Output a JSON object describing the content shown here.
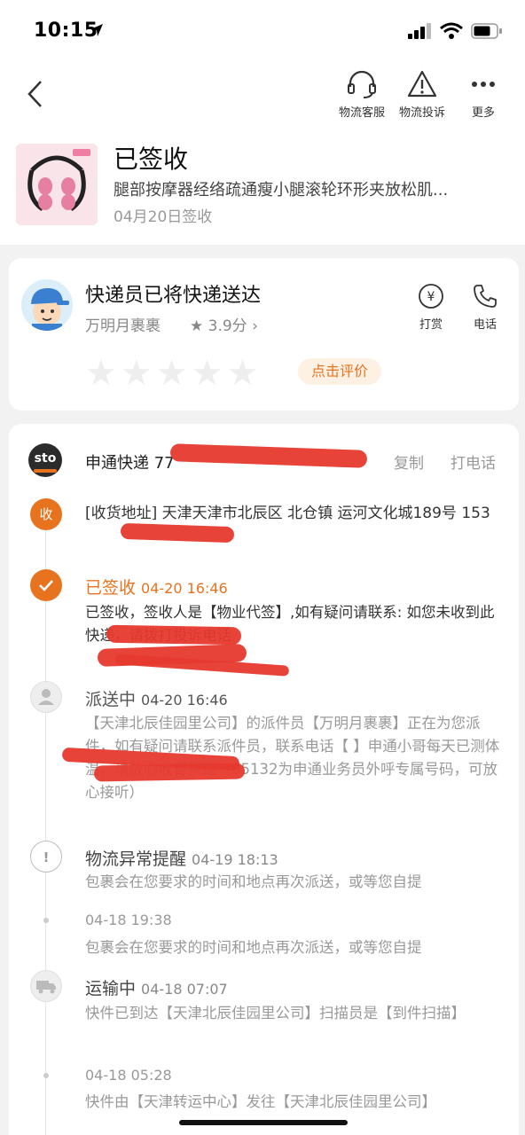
{
  "status_bar": {
    "time": "10:15"
  },
  "nav": {
    "actions": [
      {
        "label": "物流客服",
        "icon": "headset-icon"
      },
      {
        "label": "物流投诉",
        "icon": "warning-icon"
      },
      {
        "label": "更多",
        "icon": "more-icon"
      }
    ]
  },
  "product": {
    "status": "已签收",
    "name": "腿部按摩器经络疏通瘦小腿滚轮环形夹放松肌...",
    "date": "04月20日签收"
  },
  "courier": {
    "title": "快递员已将快递送达",
    "name": "万明月裹裹",
    "rating": "★ 3.9分 ›",
    "tip_label": "打赏",
    "phone_label": "电话",
    "rate_button": "点击评价"
  },
  "logistics": {
    "logo_text": "sto",
    "carrier": "申通快递 77",
    "copy": "复制",
    "call": "打电话",
    "address_node": "收",
    "address": "[收货地址] 天津天津市北辰区  北仓镇   运河文化城189号 153",
    "events": [
      {
        "title": "已签收",
        "time": "04-20 16:46",
        "body": "已签收，签收人是【物业代签】,如有疑问请联系:                     如您未收到此快递，请拨打投诉电话"
      },
      {
        "title": "派送中",
        "time": "04-20 16:46",
        "body": "【天津北辰佳园里公司】的派件员【万明月裹裹】正在为您派件，如有疑问请联系派件员，联系电话【                         】申通小哥每天已测体温，请放心收寄快递（95132为申通业务员外呼专属号码，可放心接听）"
      },
      {
        "title": "物流异常提醒",
        "time": "04-19 18:13",
        "body": "包裹会在您要求的时间和地点再次派送，或等您自提"
      },
      {
        "title": "",
        "time": "04-18 19:38",
        "body": "包裹会在您要求的时间和地点再次派送，或等您自提"
      },
      {
        "title": "运输中",
        "time": "04-18 07:07",
        "body": "快件已到达【天津北辰佳园里公司】扫描员是【到件扫描】"
      },
      {
        "title": "",
        "time": "04-18 05:28",
        "body": "快件由【天津转运中心】发往【天津北辰佳园里公司】"
      }
    ]
  },
  "colors": {
    "accent": "#e8731e",
    "redaction": "#e6392e"
  }
}
